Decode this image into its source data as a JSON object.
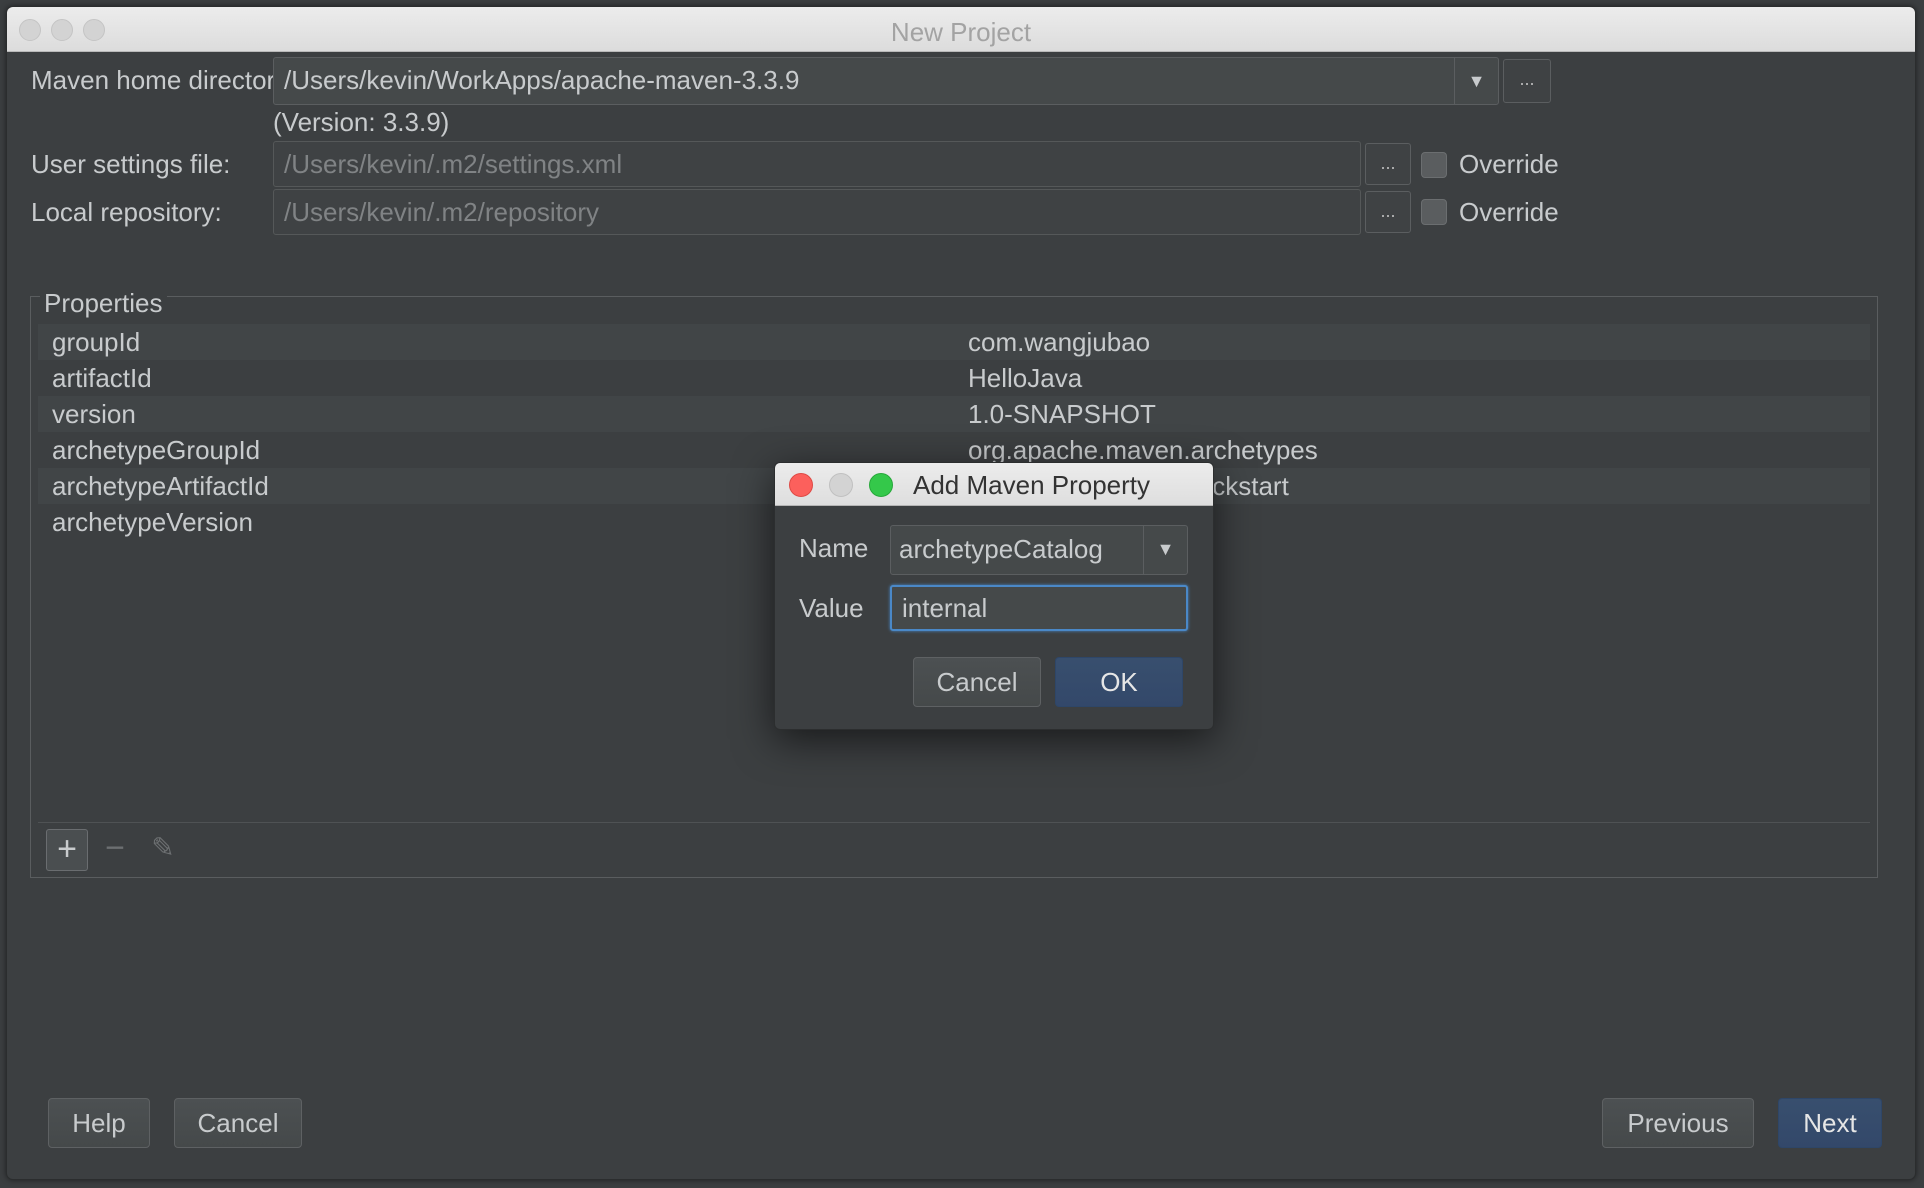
{
  "window": {
    "title": "New Project"
  },
  "form": {
    "maven_home_label": "Maven home directory:",
    "maven_home_value": "/Users/kevin/WorkApps/apache-maven-3.3.9",
    "version_text": "(Version: 3.3.9)",
    "user_settings_label": "User settings file:",
    "user_settings_value": "/Users/kevin/.m2/settings.xml",
    "local_repo_label": "Local repository:",
    "local_repo_value": "/Users/kevin/.m2/repository",
    "override_label": "Override",
    "browse_label": "..."
  },
  "properties": {
    "title": "Properties",
    "rows": [
      {
        "key": "groupId",
        "value": "com.wangjubao"
      },
      {
        "key": "artifactId",
        "value": "HelloJava"
      },
      {
        "key": "version",
        "value": "1.0-SNAPSHOT"
      },
      {
        "key": "archetypeGroupId",
        "value": "org.apache.maven.archetypes"
      },
      {
        "key": "archetypeArtifactId",
        "value": "maven-archetype-quickstart"
      },
      {
        "key": "archetypeVersion",
        "value": ""
      }
    ],
    "toolbar": {
      "add": "+",
      "remove": "−",
      "edit": "✎"
    }
  },
  "buttons": {
    "help": "Help",
    "cancel": "Cancel",
    "previous": "Previous",
    "next": "Next"
  },
  "dialog": {
    "title": "Add Maven Property",
    "name_label": "Name",
    "name_value": "archetypeCatalog",
    "value_label": "Value",
    "value_value": "internal",
    "cancel": "Cancel",
    "ok": "OK"
  },
  "colors": {
    "close": "#fc605c",
    "minimize": "#d3d3d3",
    "zoom": "#34c84a",
    "focus": "#4a88c7"
  }
}
